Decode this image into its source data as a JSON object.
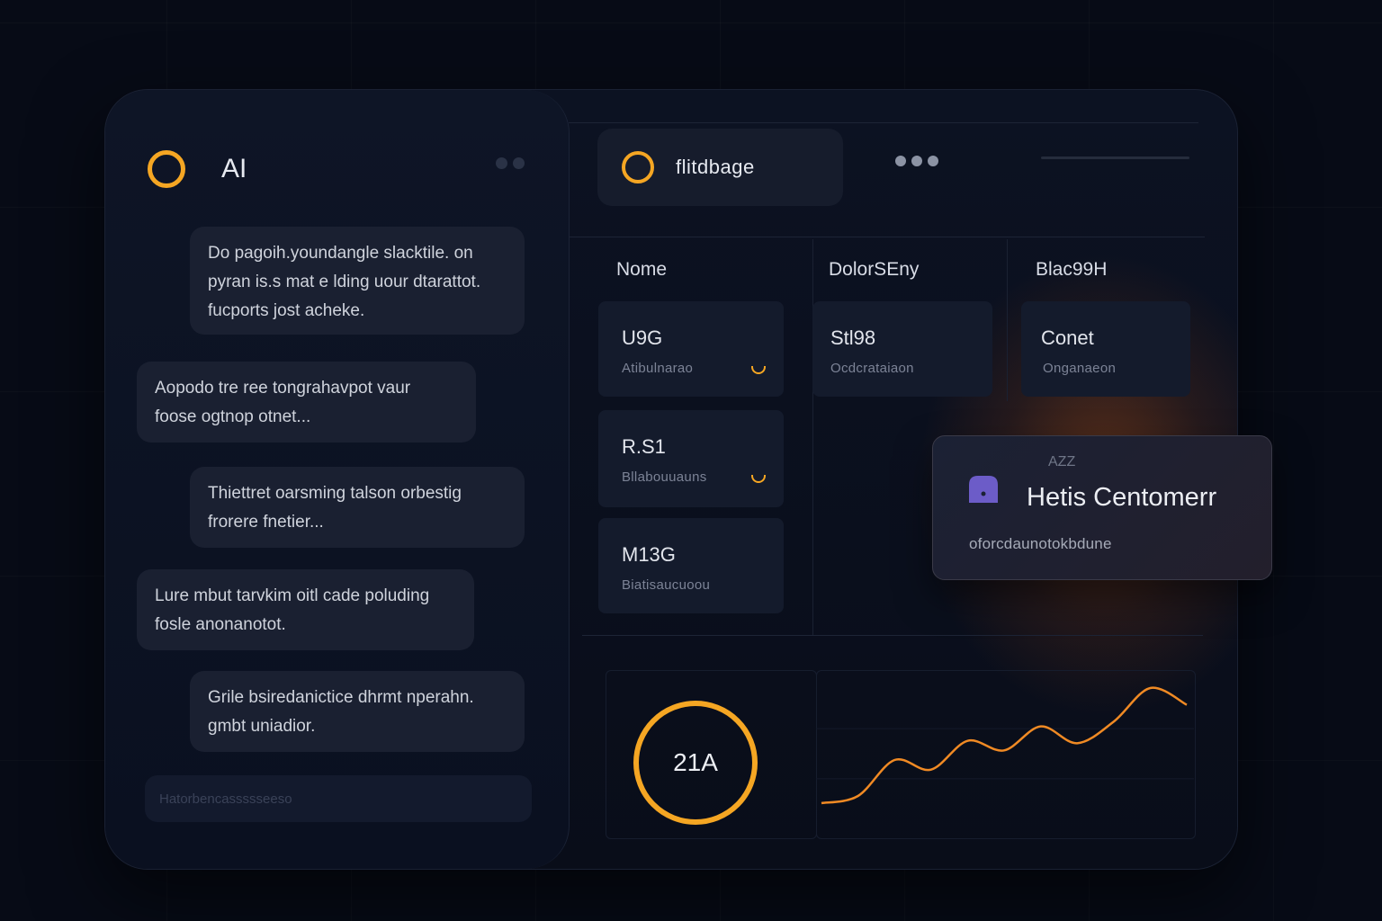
{
  "chat": {
    "title": "AI",
    "messages": [
      {
        "side": "right",
        "text": "Do pagoih.youndangle slacktile. on\npyran is.s mat e lding uour dtarattot.\nfucports jost acheke."
      },
      {
        "side": "left",
        "text": "Aopodo tre ree tongrahavpot vaur\nfoose ogtnop otnet..."
      },
      {
        "side": "right",
        "text": "Thiettret oarsming talson orbestig\nfrorere fnetier..."
      },
      {
        "side": "left",
        "text": "Lure mbut tarvkim oitl cade poluding\nfosle anonanotot."
      },
      {
        "side": "right",
        "text": "Grile bsiredanictice dhrmt nperahn.\ngmbt uniadior."
      }
    ],
    "input_placeholder": "Hatorbencassssseeso"
  },
  "tab": {
    "label": "flitdbage"
  },
  "table": {
    "columns": [
      "Nome",
      "DolorSEny",
      "Blac99H"
    ],
    "cards": [
      {
        "value": "U9G",
        "sub": "Atibulnarao",
        "mark": true
      },
      {
        "value": "Stl98",
        "sub": "Ocdcrataiaon",
        "mark": false
      },
      {
        "value": "Conet",
        "sub": "Onganaeon",
        "mark": false
      },
      {
        "value": "R.S1",
        "sub": "Bllabouuauns",
        "mark": true
      },
      {
        "value": "M13G",
        "sub": "Biatisaucuoou",
        "mark": false
      }
    ]
  },
  "popup": {
    "top": "AZZ",
    "title": "Hetis Centomerr",
    "subtitle": "oforcdaunotokbdune",
    "icon_color": "#6c5cc8"
  },
  "metric": {
    "value": "21A"
  },
  "chart_data": {
    "type": "line",
    "series": [
      {
        "values": [
          4,
          7,
          22,
          18,
          30,
          26,
          36,
          29,
          38,
          52,
          45
        ]
      }
    ],
    "color": "#f08a24",
    "grid": true
  },
  "colors": {
    "accent": "#f5a623",
    "background": "#070b16",
    "panel": "#0c1222"
  }
}
